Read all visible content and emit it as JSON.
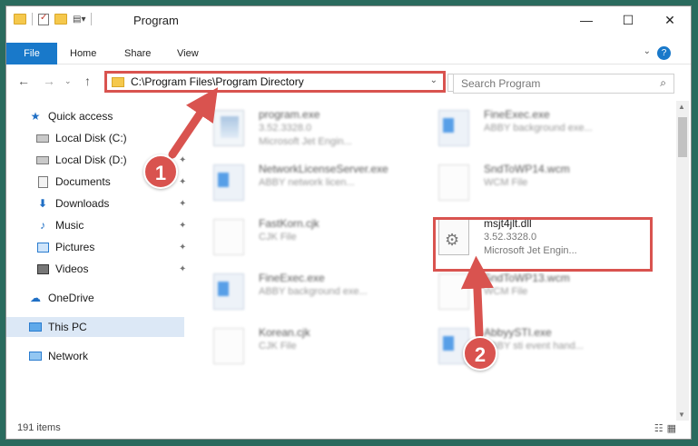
{
  "window": {
    "title": "Program",
    "controls": {
      "minimize": "—",
      "maximize": "☐",
      "close": "✕"
    }
  },
  "ribbon": {
    "tabs": [
      "File",
      "Home",
      "Share",
      "View"
    ],
    "help": "?"
  },
  "address": {
    "path": "C:\\Program Files\\Program Directory",
    "search_placeholder": "Search Program"
  },
  "sidebar": {
    "items": [
      {
        "label": "Quick access",
        "icon": "star-icon",
        "pinned": false
      },
      {
        "label": "Local Disk (C:)",
        "icon": "disk-icon",
        "pinned": true
      },
      {
        "label": "Local Disk (D:)",
        "icon": "disk-icon",
        "pinned": true
      },
      {
        "label": "Documents",
        "icon": "documents-icon",
        "pinned": true
      },
      {
        "label": "Downloads",
        "icon": "download-icon",
        "pinned": true
      },
      {
        "label": "Music",
        "icon": "music-icon",
        "pinned": true
      },
      {
        "label": "Pictures",
        "icon": "pictures-icon",
        "pinned": true
      },
      {
        "label": "Videos",
        "icon": "videos-icon",
        "pinned": true
      },
      {
        "label": "OneDrive",
        "icon": "cloud-icon",
        "pinned": false
      },
      {
        "label": "This PC",
        "icon": "computer-icon",
        "pinned": false,
        "selected": true
      },
      {
        "label": "Network",
        "icon": "network-icon",
        "pinned": false
      }
    ]
  },
  "files": [
    {
      "name": "program.exe",
      "line1": "3.52.3328.0",
      "line2": "Microsoft Jet Engin...",
      "icon": "exe-icon",
      "blurred": true
    },
    {
      "name": "FineExec.exe",
      "line1": "ABBY background exe...",
      "line2": "",
      "icon": "window-icon",
      "blurred": true
    },
    {
      "name": "NetworkLicenseServer.exe",
      "line1": "ABBY network licen...",
      "line2": "",
      "icon": "window-icon",
      "blurred": true
    },
    {
      "name": "SndToWP14.wcm",
      "line1": "WCM File",
      "line2": "",
      "icon": "page-icon",
      "blurred": true
    },
    {
      "name": "FastKorn.cjk",
      "line1": "CJK File",
      "line2": "",
      "icon": "page-icon",
      "blurred": true
    },
    {
      "name": "msjt4jlt.dll",
      "line1": "3.52.3328.0",
      "line2": "Microsoft Jet Engin...",
      "icon": "dll-icon",
      "blurred": false
    },
    {
      "name": "FineExec.exe",
      "line1": "ABBY background exe...",
      "line2": "",
      "icon": "window-icon",
      "blurred": true
    },
    {
      "name": "SndToWP13.wcm",
      "line1": "WCM File",
      "line2": "",
      "icon": "page-icon",
      "blurred": true
    },
    {
      "name": "Korean.cjk",
      "line1": "CJK File",
      "line2": "",
      "icon": "page-icon",
      "blurred": true
    },
    {
      "name": "AbbyySTI.exe",
      "line1": "ABBY sti event hand...",
      "line2": "",
      "icon": "window-icon",
      "blurred": true
    }
  ],
  "status": {
    "count": "191 items"
  },
  "annotations": [
    {
      "number": "1",
      "color": "#d9534f"
    },
    {
      "number": "2",
      "color": "#d9534f"
    }
  ]
}
